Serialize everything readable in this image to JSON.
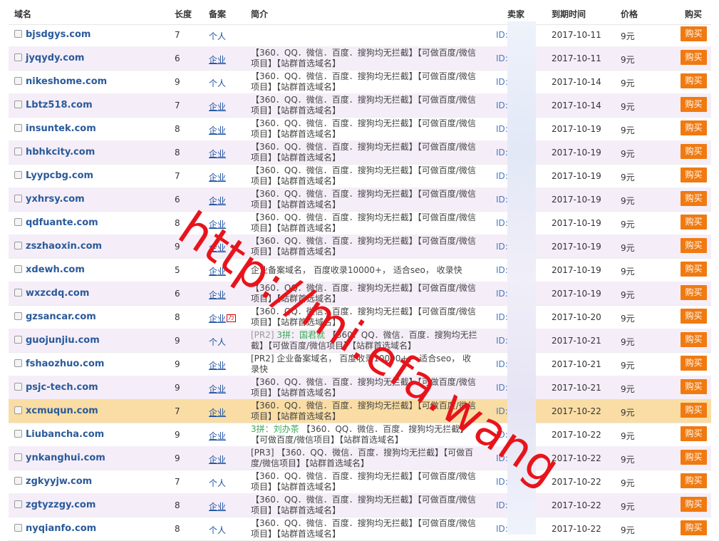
{
  "headers": {
    "domain": "域名",
    "length": "长度",
    "record": "备案",
    "desc": "简介",
    "seller": "卖家",
    "expire": "到期时间",
    "price": "价格",
    "buy": "购买"
  },
  "watermark": "http://mi.efa.wang",
  "buy_color": "#f07a10",
  "rows": [
    {
      "domain": "bjsdgys.com",
      "len": "7",
      "rec": "个人",
      "rec_link": false,
      "desc": "",
      "seller": "ID:1       8",
      "exp": "2017-10-11",
      "price": "9元",
      "buy": "购买",
      "bg": ""
    },
    {
      "domain": "jyqydy.com",
      "len": "6",
      "rec": "企业",
      "rec_link": true,
      "desc": "【360．QQ．微信．百度．搜狗均无拦截】【可做百度/微信项目】【站群首选域名】",
      "seller": "ID:      8",
      "exp": "2017-10-11",
      "price": "9元",
      "buy": "购买",
      "bg": "alt"
    },
    {
      "domain": "nikeshome.com",
      "len": "9",
      "rec": "个人",
      "rec_link": false,
      "desc": "【360．QQ．微信．百度．搜狗均无拦截】【可做百度/微信项目】【站群首选域名】",
      "seller": "ID:      8",
      "exp": "2017-10-14",
      "price": "9元",
      "buy": "购买",
      "bg": ""
    },
    {
      "domain": "Lbtz518.com",
      "len": "7",
      "rec": "企业",
      "rec_link": true,
      "desc": "【360．QQ．微信．百度．搜狗均无拦截】【可做百度/微信项目】【站群首选域名】",
      "seller": "ID:      8",
      "exp": "2017-10-14",
      "price": "9元",
      "buy": "购买",
      "bg": "alt"
    },
    {
      "domain": "insuntek.com",
      "len": "8",
      "rec": "企业",
      "rec_link": true,
      "desc": "【360．QQ．微信．百度．搜狗均无拦截】【可做百度/微信项目】【站群首选域名】",
      "seller": "ID:      8",
      "exp": "2017-10-19",
      "price": "9元",
      "buy": "购买",
      "bg": ""
    },
    {
      "domain": "hbhkcity.com",
      "len": "8",
      "rec": "企业",
      "rec_link": true,
      "desc": "【360．QQ．微信．百度．搜狗均无拦截】【可做百度/微信项目】【站群首选域名】",
      "seller": "ID:      8",
      "exp": "2017-10-19",
      "price": "9元",
      "buy": "购买",
      "bg": "alt"
    },
    {
      "domain": "Lyypcbg.com",
      "len": "7",
      "rec": "企业",
      "rec_link": true,
      "desc": "【360．QQ．微信．百度．搜狗均无拦截】【可做百度/微信项目】【站群首选域名】",
      "seller": "ID:      8",
      "exp": "2017-10-19",
      "price": "9元",
      "buy": "购买",
      "bg": ""
    },
    {
      "domain": "yxhrsy.com",
      "len": "6",
      "rec": "企业",
      "rec_link": true,
      "desc": "【360．QQ．微信．百度．搜狗均无拦截】【可做百度/微信项目】【站群首选域名】",
      "seller": "ID:      8",
      "exp": "2017-10-19",
      "price": "9元",
      "buy": "购买",
      "bg": "alt"
    },
    {
      "domain": "qdfuante.com",
      "len": "8",
      "rec": "企业",
      "rec_link": true,
      "desc": "【360．QQ．微信．百度．搜狗均无拦截】【可做百度/微信项目】【站群首选域名】",
      "seller": "ID:      8",
      "exp": "2017-10-19",
      "price": "9元",
      "buy": "购买",
      "bg": ""
    },
    {
      "domain": "zszhaoxin.com",
      "len": "9",
      "rec": "企业",
      "rec_link": true,
      "desc": "【360．QQ．微信．百度．搜狗均无拦截】【可做百度/微信项目】【站群首选域名】",
      "seller": "ID:      8",
      "exp": "2017-10-19",
      "price": "9元",
      "buy": "购买",
      "bg": "alt"
    },
    {
      "domain": "xdewh.com",
      "len": "5",
      "rec": "企业",
      "rec_link": true,
      "desc": "企业备案域名， 百度收录10000+， 适合seo， 收录快",
      "seller": "ID:      8",
      "exp": "2017-10-19",
      "price": "9元",
      "buy": "购买",
      "bg": "",
      "one": true
    },
    {
      "domain": "wxzcdq.com",
      "len": "6",
      "rec": "企业",
      "rec_link": true,
      "desc": "【360．QQ．微信．百度．搜狗均无拦截】【可做百度/微信项目】【站群首选域名】",
      "seller": "ID:      8",
      "exp": "2017-10-19",
      "price": "9元",
      "buy": "购买",
      "bg": "alt"
    },
    {
      "domain": "gzsancar.com",
      "len": "8",
      "rec": "企业",
      "rec_link": true,
      "badge": "万",
      "desc": "【360．QQ．微信．百度．搜狗均无拦截】【可做百度/微信项目】【站群首选域名】",
      "seller": "ID:     88",
      "exp": "2017-10-20",
      "price": "9元",
      "buy": "购买",
      "bg": ""
    },
    {
      "domain": "guojunjiu.com",
      "len": "9",
      "rec": "个人",
      "rec_link": false,
      "desc_pre": "[PR2] ",
      "desc_green": "3拼：国君就",
      "desc": " 【360．QQ．微信．百度．搜狗均无拦截】【可做百度/微信项目】【站群首选域名】",
      "seller": "ID:     88",
      "exp": "2017-10-21",
      "price": "9元",
      "buy": "购买",
      "bg": "alt"
    },
    {
      "domain": "fshaozhuo.com",
      "len": "9",
      "rec": "企业",
      "rec_link": true,
      "desc": "[PR2] 企业备案域名， 百度收录10000+， 适合seo， 收录快",
      "seller": "ID:     88",
      "exp": "2017-10-21",
      "price": "9元",
      "buy": "购买",
      "bg": ""
    },
    {
      "domain": "psjc-tech.com",
      "len": "9",
      "rec": "企业",
      "rec_link": true,
      "desc": "【360．QQ．微信．百度．搜狗均无拦截】【可做百度/微信项目】【站群首选域名】",
      "seller": "ID:     88",
      "exp": "2017-10-21",
      "price": "9元",
      "buy": "购买",
      "bg": "alt"
    },
    {
      "domain": "xcmuqun.com",
      "len": "7",
      "rec": "企业",
      "rec_link": true,
      "desc": "【360．QQ．微信．百度．搜狗均无拦截】【可做百度/微信项目】【站群首选域名】",
      "seller": "ID:     88",
      "exp": "2017-10-22",
      "price": "9元",
      "buy": "购买",
      "bg": "hl"
    },
    {
      "domain": "Liubancha.com",
      "len": "9",
      "rec": "企业",
      "rec_link": true,
      "desc_green": "3拼：刘办茶",
      "desc": " 【360．QQ．微信．百度．搜狗均无拦截】【可做百度/微信项目】【站群首选域名】",
      "seller": "ID:     88",
      "exp": "2017-10-22",
      "price": "9元",
      "buy": "购买",
      "bg": ""
    },
    {
      "domain": "ynkanghui.com",
      "len": "9",
      "rec": "企业",
      "rec_link": true,
      "desc": "[PR3] 【360．QQ．微信．百度．搜狗均无拦截】【可做百度/微信项目】【站群首选域名】",
      "seller": "ID:     88",
      "exp": "2017-10-22",
      "price": "9元",
      "buy": "购买",
      "bg": "alt"
    },
    {
      "domain": "zgkyyjw.com",
      "len": "7",
      "rec": "个人",
      "rec_link": false,
      "desc": "【360．QQ．微信．百度．搜狗均无拦截】【可做百度/微信项目】【站群首选域名】",
      "seller": "ID:     88",
      "exp": "2017-10-22",
      "price": "9元",
      "buy": "购买",
      "bg": ""
    },
    {
      "domain": "zgtyzzgy.com",
      "len": "8",
      "rec": "企业",
      "rec_link": true,
      "desc": "【360．QQ．微信．百度．搜狗均无拦截】【可做百度/微信项目】【站群首选域名】",
      "seller": "ID:      8",
      "exp": "2017-10-22",
      "price": "9元",
      "buy": "购买",
      "bg": "alt"
    },
    {
      "domain": "nyqianfo.com",
      "len": "8",
      "rec": "个人",
      "rec_link": false,
      "desc": "【360．QQ．微信．百度．搜狗均无拦截】【可做百度/微信项目】【站群首选域名】",
      "seller": "ID:9     3",
      "exp": "2017-10-22",
      "price": "9元",
      "buy": "购买",
      "bg": ""
    }
  ]
}
